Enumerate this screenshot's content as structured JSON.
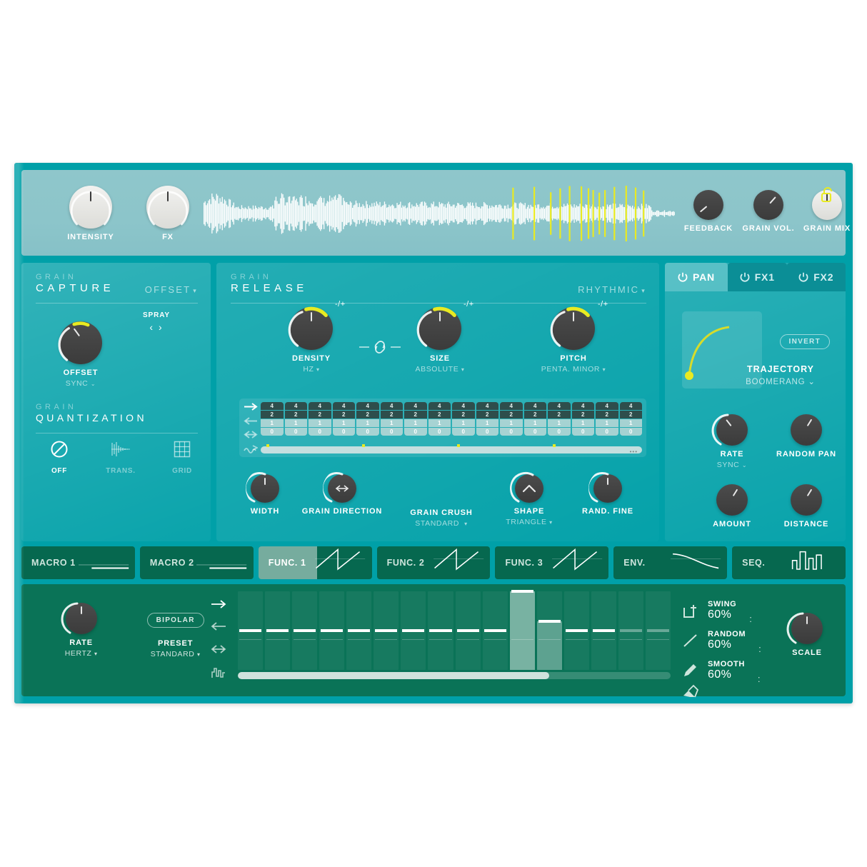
{
  "app": {
    "name": "granular-synth-plugin"
  },
  "topbar": {
    "knobs": [
      {
        "label": "INTENSITY",
        "style": "light",
        "angle": 0,
        "arc": 0
      },
      {
        "label": "FX",
        "style": "light",
        "angle": 0,
        "arc": 0
      },
      {
        "label": "FEEDBACK",
        "style": "dark",
        "angle": -135,
        "arc": 0
      },
      {
        "label": "GRAIN VOL.",
        "style": "dark",
        "angle": 45,
        "arc": 0
      },
      {
        "label": "GRAIN MIX",
        "style": "light",
        "angle": 0,
        "arc": 0
      }
    ],
    "lock_icon": "unlock-icon",
    "waveform_icon": "audio-waveform"
  },
  "capture": {
    "title_small": "GRAIN",
    "title_big": "CAPTURE",
    "mode": "OFFSET",
    "mode_caret": "▾",
    "spray_label": "SPRAY",
    "spray_arrows": "‹ ›",
    "knob_label": "OFFSET",
    "knob_sub": "SYNC",
    "quant_small": "GRAIN",
    "quant_big": "QUANTIZATION",
    "quant_options": [
      {
        "label": "OFF",
        "icon": "no-entry-icon",
        "active": true
      },
      {
        "label": "TRANS.",
        "icon": "transient-icon",
        "active": false
      },
      {
        "label": "GRID",
        "icon": "grid-icon",
        "active": false
      }
    ]
  },
  "release": {
    "title_small": "GRAIN",
    "title_big": "RELEASE",
    "mode": "RHYTHMIC",
    "mode_caret": "▾",
    "main_knobs": [
      {
        "label": "DENSITY",
        "sub": "HZ",
        "badge": "-/+",
        "has_caret": true
      },
      {
        "label": "SIZE",
        "sub": "ABSOLUTE",
        "badge": "-/+",
        "has_caret": true
      },
      {
        "label": "PITCH",
        "sub": "PENTA. MINOR",
        "badge": "-/+",
        "has_caret": true
      }
    ],
    "link_icon": "link-icon",
    "grid": {
      "direction_icons": [
        "arrow-right-icon",
        "arrow-left-icon",
        "arrow-both-icon",
        "arrow-random-icon"
      ],
      "active_direction": 0,
      "rows": [
        "4",
        "2",
        "1",
        "0"
      ],
      "columns": 16,
      "accent_marks": [
        0,
        4,
        8,
        12
      ],
      "overflow_dots": "•••"
    },
    "bottom_knobs": [
      {
        "label": "WIDTH",
        "sub": "",
        "icon": ""
      },
      {
        "label": "GRAIN DIRECTION",
        "sub": "",
        "icon": "arrow-both-icon"
      },
      {
        "label": "GRAIN CRUSH",
        "sub": "STANDARD",
        "icon": ""
      },
      {
        "label": "SHAPE",
        "sub": "TRIANGLE",
        "icon": "triangle-shape-icon"
      },
      {
        "label": "RAND. FINE",
        "sub": "",
        "icon": ""
      }
    ]
  },
  "pan": {
    "tabs": [
      {
        "label": "PAN",
        "active": true,
        "power_icon": "power-icon"
      },
      {
        "label": "FX1",
        "active": false,
        "power_icon": "power-icon"
      },
      {
        "label": "FX2",
        "active": false,
        "power_icon": "power-icon"
      }
    ],
    "invert_label": "INVERT",
    "trajectory_label": "TRAJECTORY",
    "trajectory_value": "BOOMERANG",
    "trajectory_caret": "⌄",
    "knobs": [
      {
        "label": "RATE",
        "sub": "SYNC",
        "has_caret": true
      },
      {
        "label": "RANDOM PAN",
        "sub": "",
        "has_caret": false
      },
      {
        "label": "AMOUNT",
        "sub": "",
        "has_caret": false
      },
      {
        "label": "DISTANCE",
        "sub": "",
        "has_caret": false
      }
    ],
    "curve_icon": "pan-trajectory-curve"
  },
  "modstrip": {
    "tabs": [
      {
        "label": "MACRO 1",
        "shape": "flat-line",
        "selected": false
      },
      {
        "label": "MACRO 2",
        "shape": "flat-line",
        "selected": false
      },
      {
        "label": "FUNC. 1",
        "shape": "saw-ramp",
        "selected": true
      },
      {
        "label": "FUNC. 2",
        "shape": "saw-ramp",
        "selected": false
      },
      {
        "label": "FUNC. 3",
        "shape": "saw-ramp",
        "selected": false
      },
      {
        "label": "ENV.",
        "shape": "decay-curve",
        "selected": false
      },
      {
        "label": "SEQ.",
        "shape": "step-bars",
        "selected": false
      }
    ]
  },
  "bottom": {
    "rate": {
      "label": "RATE",
      "sub": "HERTZ",
      "caret": "▾"
    },
    "bipolar_label": "BIPOLAR",
    "preset": {
      "label": "PRESET",
      "value": "STANDARD",
      "caret": "▾"
    },
    "direction_icons": [
      "arrow-right-icon",
      "arrow-left-icon",
      "arrow-both-icon",
      "step-random-icon"
    ],
    "active_direction": 0,
    "steps": {
      "count": 16,
      "values": [
        50,
        50,
        50,
        50,
        50,
        50,
        50,
        50,
        50,
        50,
        100,
        62,
        50,
        50,
        50,
        50
      ],
      "highlighted": [
        10,
        11
      ],
      "dim": [
        14,
        15
      ]
    },
    "slider_percent": 72,
    "params": [
      {
        "label": "SWING",
        "value": "60%",
        "icon": "add-rect-icon",
        "colon": ":"
      },
      {
        "label": "RANDOM",
        "value": "60%",
        "icon": "line-icon",
        "colon": ":"
      },
      {
        "label": "SMOOTH",
        "value": "60%",
        "icon": "pencil-icon",
        "colon": ":"
      }
    ],
    "extra_icon": "eraser-icon",
    "scale": {
      "label": "SCALE"
    }
  },
  "colors": {
    "shell": "#00a0a8",
    "topbar": "#8cc5ca",
    "panel_teal": "#3aa39f",
    "accent_yellow": "#e8ea22",
    "mod_strip": "#06684f",
    "bottom_panel": "#0a7357",
    "knob_dark": "#474747",
    "knob_light": "#eeeeec"
  }
}
